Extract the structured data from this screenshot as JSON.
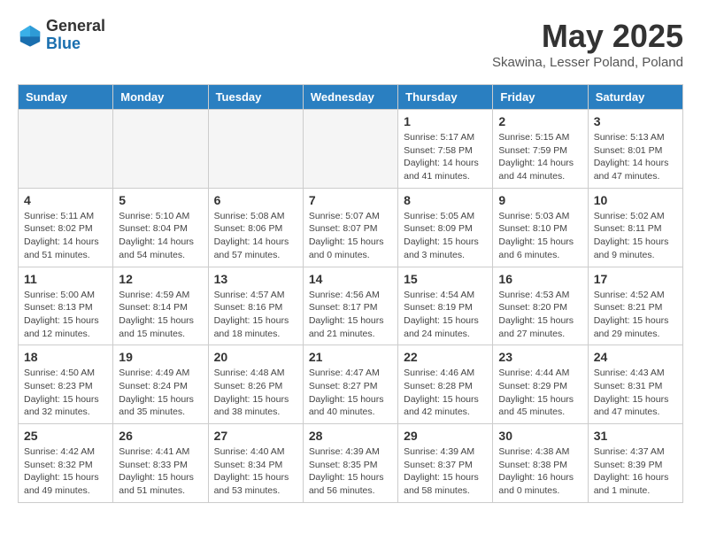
{
  "header": {
    "logo_general": "General",
    "logo_blue": "Blue",
    "month_title": "May 2025",
    "location": "Skawina, Lesser Poland, Poland"
  },
  "days_of_week": [
    "Sunday",
    "Monday",
    "Tuesday",
    "Wednesday",
    "Thursday",
    "Friday",
    "Saturday"
  ],
  "weeks": [
    [
      {
        "num": "",
        "info": ""
      },
      {
        "num": "",
        "info": ""
      },
      {
        "num": "",
        "info": ""
      },
      {
        "num": "",
        "info": ""
      },
      {
        "num": "1",
        "info": "Sunrise: 5:17 AM\nSunset: 7:58 PM\nDaylight: 14 hours\nand 41 minutes."
      },
      {
        "num": "2",
        "info": "Sunrise: 5:15 AM\nSunset: 7:59 PM\nDaylight: 14 hours\nand 44 minutes."
      },
      {
        "num": "3",
        "info": "Sunrise: 5:13 AM\nSunset: 8:01 PM\nDaylight: 14 hours\nand 47 minutes."
      }
    ],
    [
      {
        "num": "4",
        "info": "Sunrise: 5:11 AM\nSunset: 8:02 PM\nDaylight: 14 hours\nand 51 minutes."
      },
      {
        "num": "5",
        "info": "Sunrise: 5:10 AM\nSunset: 8:04 PM\nDaylight: 14 hours\nand 54 minutes."
      },
      {
        "num": "6",
        "info": "Sunrise: 5:08 AM\nSunset: 8:06 PM\nDaylight: 14 hours\nand 57 minutes."
      },
      {
        "num": "7",
        "info": "Sunrise: 5:07 AM\nSunset: 8:07 PM\nDaylight: 15 hours\nand 0 minutes."
      },
      {
        "num": "8",
        "info": "Sunrise: 5:05 AM\nSunset: 8:09 PM\nDaylight: 15 hours\nand 3 minutes."
      },
      {
        "num": "9",
        "info": "Sunrise: 5:03 AM\nSunset: 8:10 PM\nDaylight: 15 hours\nand 6 minutes."
      },
      {
        "num": "10",
        "info": "Sunrise: 5:02 AM\nSunset: 8:11 PM\nDaylight: 15 hours\nand 9 minutes."
      }
    ],
    [
      {
        "num": "11",
        "info": "Sunrise: 5:00 AM\nSunset: 8:13 PM\nDaylight: 15 hours\nand 12 minutes."
      },
      {
        "num": "12",
        "info": "Sunrise: 4:59 AM\nSunset: 8:14 PM\nDaylight: 15 hours\nand 15 minutes."
      },
      {
        "num": "13",
        "info": "Sunrise: 4:57 AM\nSunset: 8:16 PM\nDaylight: 15 hours\nand 18 minutes."
      },
      {
        "num": "14",
        "info": "Sunrise: 4:56 AM\nSunset: 8:17 PM\nDaylight: 15 hours\nand 21 minutes."
      },
      {
        "num": "15",
        "info": "Sunrise: 4:54 AM\nSunset: 8:19 PM\nDaylight: 15 hours\nand 24 minutes."
      },
      {
        "num": "16",
        "info": "Sunrise: 4:53 AM\nSunset: 8:20 PM\nDaylight: 15 hours\nand 27 minutes."
      },
      {
        "num": "17",
        "info": "Sunrise: 4:52 AM\nSunset: 8:21 PM\nDaylight: 15 hours\nand 29 minutes."
      }
    ],
    [
      {
        "num": "18",
        "info": "Sunrise: 4:50 AM\nSunset: 8:23 PM\nDaylight: 15 hours\nand 32 minutes."
      },
      {
        "num": "19",
        "info": "Sunrise: 4:49 AM\nSunset: 8:24 PM\nDaylight: 15 hours\nand 35 minutes."
      },
      {
        "num": "20",
        "info": "Sunrise: 4:48 AM\nSunset: 8:26 PM\nDaylight: 15 hours\nand 38 minutes."
      },
      {
        "num": "21",
        "info": "Sunrise: 4:47 AM\nSunset: 8:27 PM\nDaylight: 15 hours\nand 40 minutes."
      },
      {
        "num": "22",
        "info": "Sunrise: 4:46 AM\nSunset: 8:28 PM\nDaylight: 15 hours\nand 42 minutes."
      },
      {
        "num": "23",
        "info": "Sunrise: 4:44 AM\nSunset: 8:29 PM\nDaylight: 15 hours\nand 45 minutes."
      },
      {
        "num": "24",
        "info": "Sunrise: 4:43 AM\nSunset: 8:31 PM\nDaylight: 15 hours\nand 47 minutes."
      }
    ],
    [
      {
        "num": "25",
        "info": "Sunrise: 4:42 AM\nSunset: 8:32 PM\nDaylight: 15 hours\nand 49 minutes."
      },
      {
        "num": "26",
        "info": "Sunrise: 4:41 AM\nSunset: 8:33 PM\nDaylight: 15 hours\nand 51 minutes."
      },
      {
        "num": "27",
        "info": "Sunrise: 4:40 AM\nSunset: 8:34 PM\nDaylight: 15 hours\nand 53 minutes."
      },
      {
        "num": "28",
        "info": "Sunrise: 4:39 AM\nSunset: 8:35 PM\nDaylight: 15 hours\nand 56 minutes."
      },
      {
        "num": "29",
        "info": "Sunrise: 4:39 AM\nSunset: 8:37 PM\nDaylight: 15 hours\nand 58 minutes."
      },
      {
        "num": "30",
        "info": "Sunrise: 4:38 AM\nSunset: 8:38 PM\nDaylight: 16 hours\nand 0 minutes."
      },
      {
        "num": "31",
        "info": "Sunrise: 4:37 AM\nSunset: 8:39 PM\nDaylight: 16 hours\nand 1 minute."
      }
    ]
  ]
}
